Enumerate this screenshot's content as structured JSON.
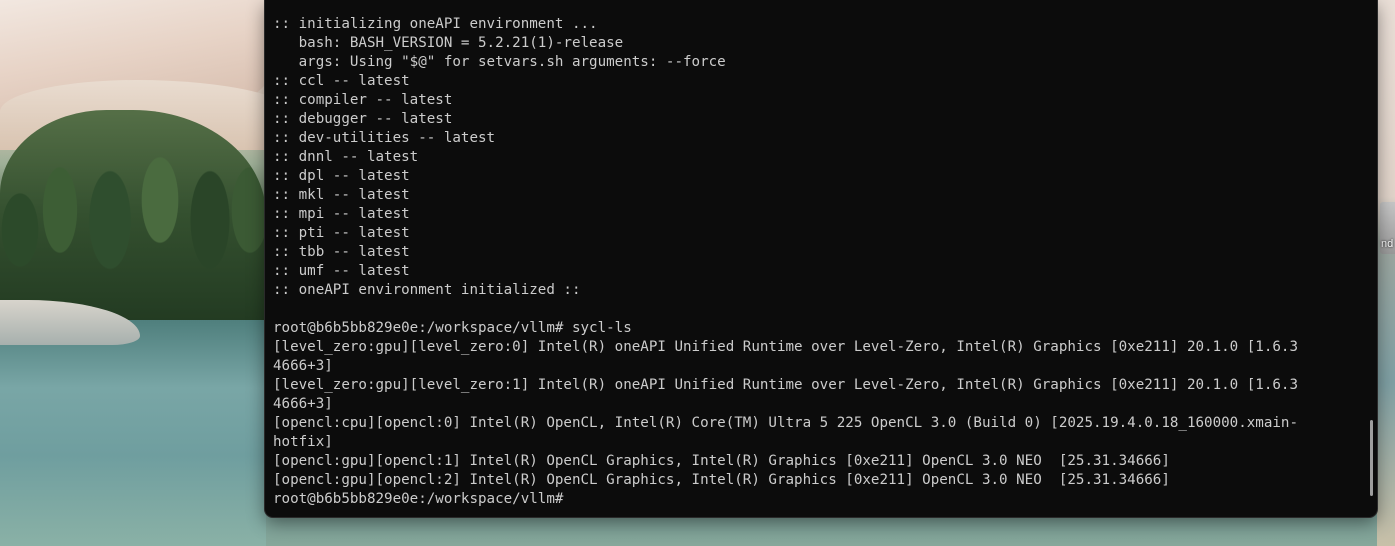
{
  "desktop": {
    "icon_label": "nd"
  },
  "terminal": {
    "lines": [
      ":: initializing oneAPI environment ...",
      "   bash: BASH_VERSION = 5.2.21(1)-release",
      "   args: Using \"$@\" for setvars.sh arguments: --force",
      ":: ccl -- latest",
      ":: compiler -- latest",
      ":: debugger -- latest",
      ":: dev-utilities -- latest",
      ":: dnnl -- latest",
      ":: dpl -- latest",
      ":: mkl -- latest",
      ":: mpi -- latest",
      ":: pti -- latest",
      ":: tbb -- latest",
      ":: umf -- latest",
      ":: oneAPI environment initialized ::",
      "",
      "root@b6b5bb829e0e:/workspace/vllm# sycl-ls",
      "[level_zero:gpu][level_zero:0] Intel(R) oneAPI Unified Runtime over Level-Zero, Intel(R) Graphics [0xe211] 20.1.0 [1.6.3",
      "4666+3]",
      "[level_zero:gpu][level_zero:1] Intel(R) oneAPI Unified Runtime over Level-Zero, Intel(R) Graphics [0xe211] 20.1.0 [1.6.3",
      "4666+3]",
      "[opencl:cpu][opencl:0] Intel(R) OpenCL, Intel(R) Core(TM) Ultra 5 225 OpenCL 3.0 (Build 0) [2025.19.4.0.18_160000.xmain-",
      "hotfix]",
      "[opencl:gpu][opencl:1] Intel(R) OpenCL Graphics, Intel(R) Graphics [0xe211] OpenCL 3.0 NEO  [25.31.34666]",
      "[opencl:gpu][opencl:2] Intel(R) OpenCL Graphics, Intel(R) Graphics [0xe211] OpenCL 3.0 NEO  [25.31.34666]",
      "root@b6b5bb829e0e:/workspace/vllm#"
    ]
  }
}
